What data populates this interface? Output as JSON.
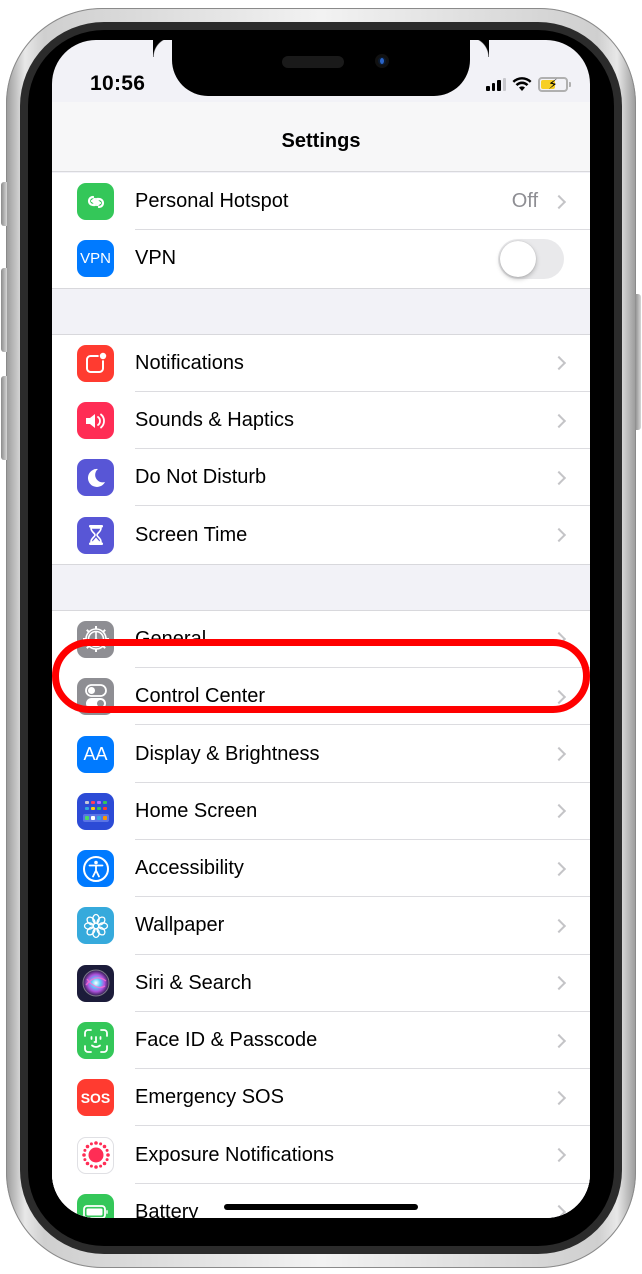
{
  "status_bar": {
    "time": "10:56",
    "signal_bars_active": 3,
    "signal_bars_total": 4,
    "wifi": "connected",
    "battery_state": "charging",
    "battery_color": "#f7cf26"
  },
  "header": {
    "title": "Settings"
  },
  "groups": [
    {
      "items": [
        {
          "id": "personal-hotspot",
          "label": "Personal Hotspot",
          "value": "Off",
          "icon": "personal-hotspot-icon",
          "color": "#34c759",
          "accessory": "chevron"
        },
        {
          "id": "vpn",
          "label": "VPN",
          "icon": "vpn-icon",
          "icon_text": "VPN",
          "color": "#007aff",
          "accessory": "toggle",
          "toggle_on": false
        }
      ]
    },
    {
      "items": [
        {
          "id": "notifications",
          "label": "Notifications",
          "icon": "notifications-icon",
          "color": "#ff3b30",
          "accessory": "chevron"
        },
        {
          "id": "sounds-haptics",
          "label": "Sounds & Haptics",
          "icon": "speaker-icon",
          "color": "#ff2d55",
          "accessory": "chevron"
        },
        {
          "id": "do-not-disturb",
          "label": "Do Not Disturb",
          "icon": "moon-icon",
          "color": "#5856d6",
          "accessory": "chevron"
        },
        {
          "id": "screen-time",
          "label": "Screen Time",
          "icon": "hourglass-icon",
          "color": "#5856d6",
          "accessory": "chevron"
        }
      ]
    },
    {
      "items": [
        {
          "id": "general",
          "label": "General",
          "icon": "gear-icon",
          "color": "#8e8e93",
          "accessory": "chevron",
          "highlighted": true
        },
        {
          "id": "control-center",
          "label": "Control Center",
          "icon": "switches-icon",
          "color": "#8e8e93",
          "accessory": "chevron"
        },
        {
          "id": "display-brightness",
          "label": "Display & Brightness",
          "icon": "text-size-icon",
          "icon_text": "AA",
          "color": "#007aff",
          "accessory": "chevron"
        },
        {
          "id": "home-screen",
          "label": "Home Screen",
          "icon": "home-screen-grid-icon",
          "color": "#2c4bd6",
          "accessory": "chevron"
        },
        {
          "id": "accessibility",
          "label": "Accessibility",
          "icon": "accessibility-icon",
          "color": "#007aff",
          "accessory": "chevron"
        },
        {
          "id": "wallpaper",
          "label": "Wallpaper",
          "icon": "flower-icon",
          "color": "#36aadc",
          "accessory": "chevron"
        },
        {
          "id": "siri-search",
          "label": "Siri & Search",
          "icon": "siri-icon",
          "color": "#1c1c3a",
          "accessory": "chevron"
        },
        {
          "id": "face-id-passcode",
          "label": "Face ID & Passcode",
          "icon": "face-id-icon",
          "color": "#34c759",
          "accessory": "chevron"
        },
        {
          "id": "emergency-sos",
          "label": "Emergency SOS",
          "icon": "sos-icon",
          "icon_text": "SOS",
          "color": "#ff3b30",
          "accessory": "chevron"
        },
        {
          "id": "exposure-notifications",
          "label": "Exposure Notifications",
          "icon": "exposure-icon",
          "color": "#ffffff",
          "accessory": "chevron"
        },
        {
          "id": "battery",
          "label": "Battery",
          "icon": "battery-icon",
          "color": "#34c759",
          "accessory": "chevron"
        }
      ]
    }
  ],
  "annotation": {
    "highlight_target": "General",
    "highlight_color": "#ff0000"
  }
}
